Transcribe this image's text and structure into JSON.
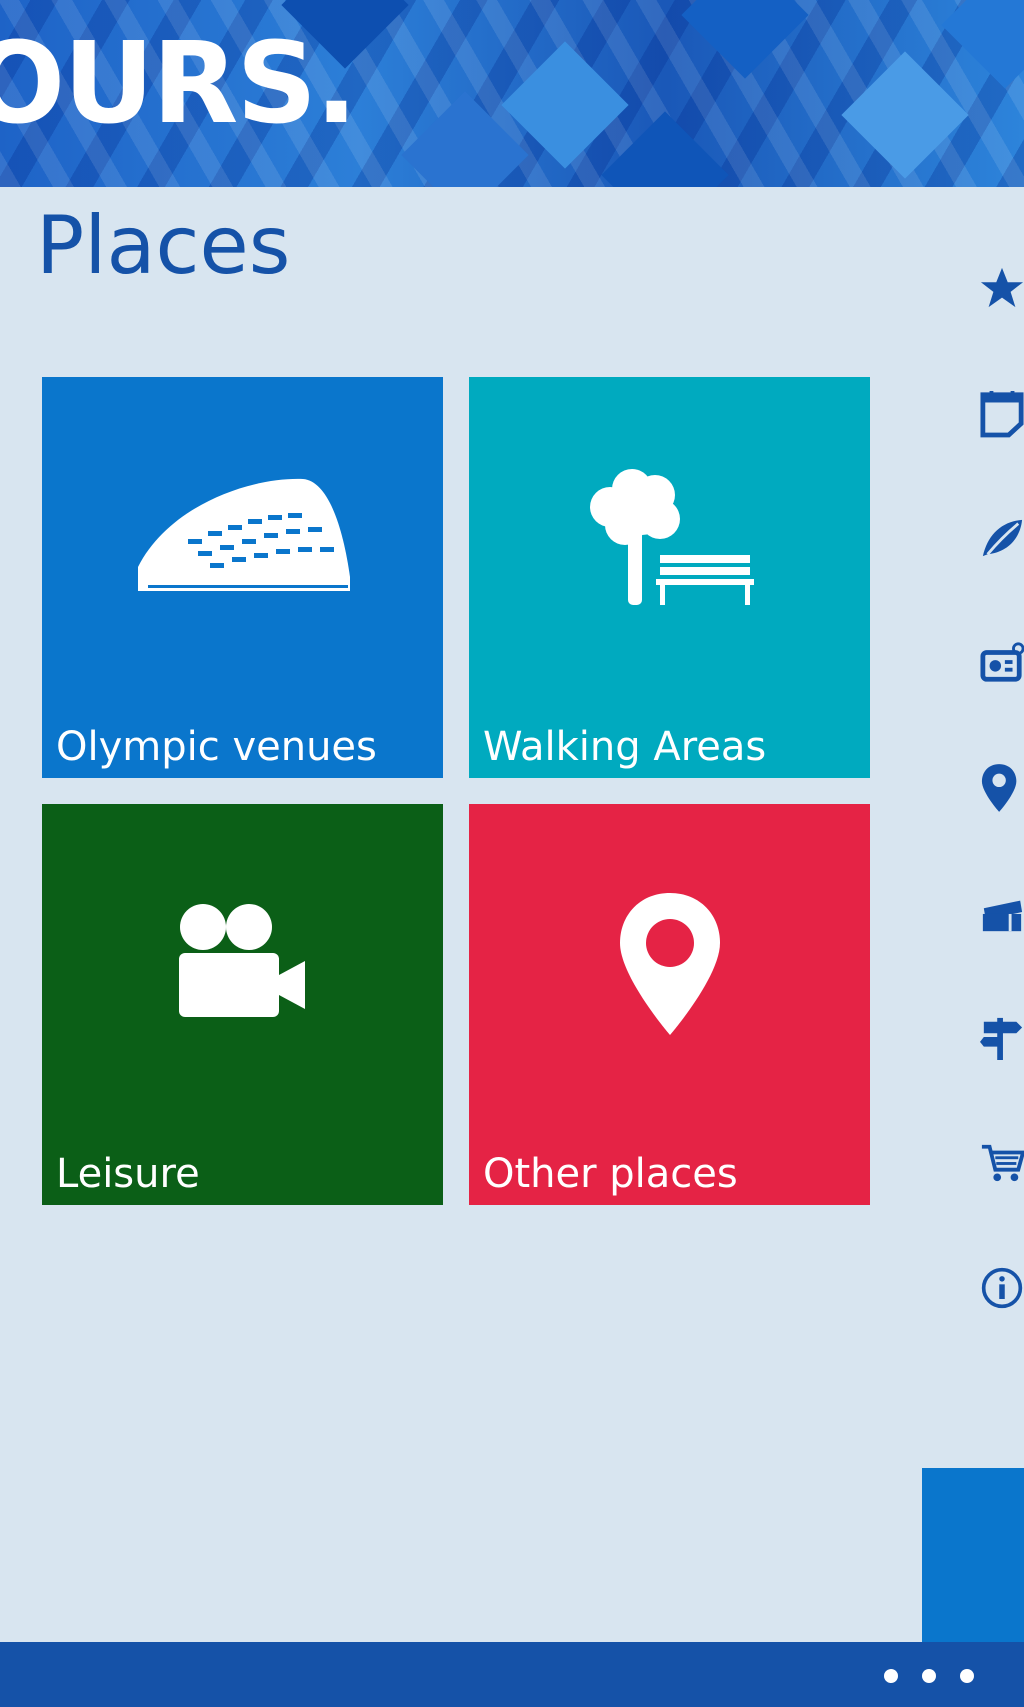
{
  "header": {
    "logo_text": "OURS."
  },
  "page": {
    "title": "Places"
  },
  "tiles": [
    {
      "label": "Olympic venues",
      "icon": "stadium-icon",
      "color": "#0a76cc"
    },
    {
      "label": "Walking Areas",
      "icon": "tree-bench-icon",
      "color": "#00aabf"
    },
    {
      "label": "Leisure",
      "icon": "video-camera-icon",
      "color": "#0b5f17"
    },
    {
      "label": "Other places",
      "icon": "map-pin-icon",
      "color": "#e52345"
    }
  ],
  "side_rail": {
    "icons": [
      "star-icon",
      "calendar-icon",
      "leaf-icon",
      "radio-icon",
      "location-pin-icon",
      "tickets-icon",
      "signpost-icon",
      "cart-icon",
      "info-icon"
    ],
    "color": "#1552a8"
  },
  "app_bar": {
    "more_icon": "ellipsis-icon",
    "color": "#1552a8"
  }
}
